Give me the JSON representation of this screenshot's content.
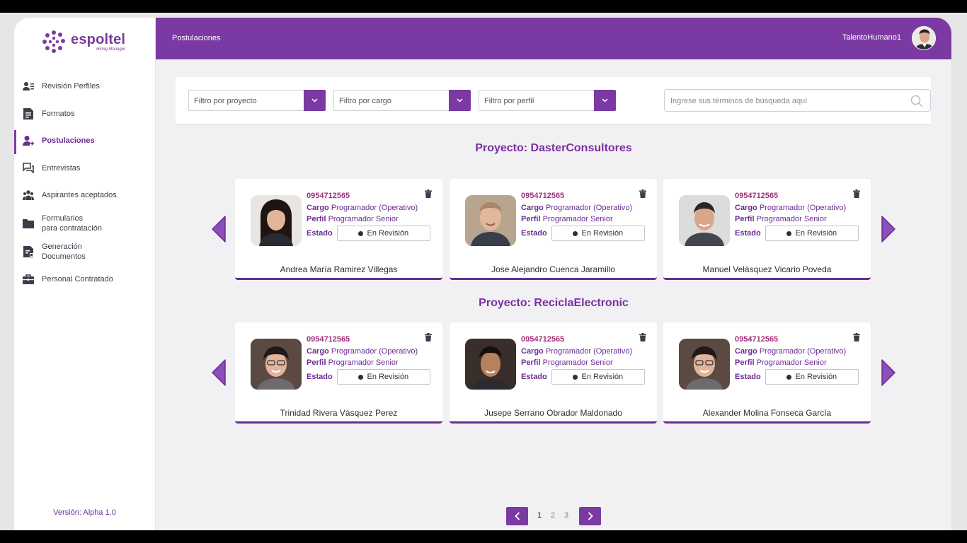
{
  "brand": {
    "name": "espoltel",
    "subtitle": "Hiring Manager",
    "accent": "#7b3aa3"
  },
  "sidebar": {
    "items": [
      {
        "label": "Revisión Perfiles",
        "icon": "profile-list-icon"
      },
      {
        "label": "Formatos",
        "icon": "document-icon"
      },
      {
        "label": "Postulaciones",
        "icon": "add-user-icon",
        "active": true
      },
      {
        "label": "Entrevistas",
        "icon": "chat-icon"
      },
      {
        "label": "Aspirantes aceptados",
        "icon": "group-icon"
      },
      {
        "label": "Formularios\npara contratación",
        "icon": "folder-icon"
      },
      {
        "label": "Generación\nDocumentos",
        "icon": "document-gen-icon"
      },
      {
        "label": "Personal Contratado",
        "icon": "briefcase-icon"
      }
    ],
    "version": "Versión: Alpha 1.0"
  },
  "header": {
    "title": "Postulaciones",
    "user": "TalentoHumano1"
  },
  "filters": {
    "project": "Filtro por proyecto",
    "role": "Filtro por cargo",
    "profile": "Filtro por perfil",
    "search_placeholder": "Ingrese sus términos de búsqueda aquí"
  },
  "labels": {
    "cargo": "Cargo",
    "perfil": "Perfil",
    "estado": "Estado"
  },
  "projects": [
    {
      "title": "Proyecto: DasterConsultores",
      "cards": [
        {
          "id": "0954712565",
          "cargo": "Programador (Operativo)",
          "perfil": "Programador Senior",
          "estado": "En Revisión",
          "name": "Andrea María Ramirez Villegas"
        },
        {
          "id": "0954712565",
          "cargo": "Programador (Operativo)",
          "perfil": "Programador Senior",
          "estado": "En Revisión",
          "name": "Jose Alejandro Cuenca Jaramillo"
        },
        {
          "id": "0954712565",
          "cargo": "Programador (Operativo)",
          "perfil": "Programador Senior",
          "estado": "En Revisión",
          "name": "Manuel Velásquez Vicario Poveda"
        }
      ]
    },
    {
      "title": "Proyecto: ReciclaElectronic",
      "cards": [
        {
          "id": "0954712565",
          "cargo": "Programador (Operativo)",
          "perfil": "Programador Senior",
          "estado": "En Revisión",
          "name": "Trinidad Rivera Vásquez Perez"
        },
        {
          "id": "0954712565",
          "cargo": "Programador (Operativo)",
          "perfil": "Programador Senior",
          "estado": "En Revisión",
          "name": "Jusepe Serrano Obrador Maldonado"
        },
        {
          "id": "0954712565",
          "cargo": "Programador (Operativo)",
          "perfil": "Programador Senior",
          "estado": "En Revisión",
          "name": "Alexander Molina Fonseca García"
        }
      ]
    }
  ],
  "pagination": {
    "pages": [
      "1",
      "2",
      "3"
    ],
    "current": "1"
  }
}
